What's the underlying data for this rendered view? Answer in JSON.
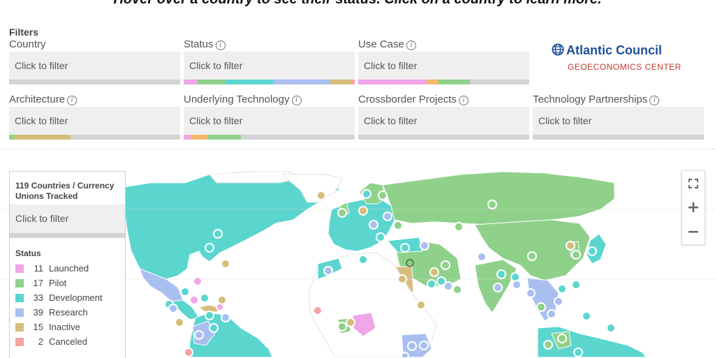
{
  "headline": "Hover over a country to see their status. Click on a country to learn more.",
  "filters": {
    "title": "Filters",
    "placeholder": "Click to filter",
    "info_symbol": "i",
    "items": [
      {
        "label": "Country",
        "has_info": false
      },
      {
        "label": "Status",
        "has_info": true
      },
      {
        "label": "Use Case",
        "has_info": true
      },
      {
        "label": "Architecture",
        "has_info": true
      },
      {
        "label": "Underlying Technology",
        "has_info": true
      },
      {
        "label": "Crossborder Projects",
        "has_info": true
      },
      {
        "label": "Technology Partnerships",
        "has_info": true
      }
    ]
  },
  "logo": {
    "name": "Atlantic Council",
    "subtitle": "GEOECONOMICS CENTER",
    "icon": "globe-icon",
    "color": "#1e4f9a",
    "subtitle_color": "#c0392b"
  },
  "legend": {
    "title": "119 Countries / Currency Unions Tracked",
    "placeholder": "Click to filter",
    "status_title": "Status",
    "statuses": [
      {
        "count": "11",
        "label": "Launched",
        "color": "#f0a6e8"
      },
      {
        "count": "17",
        "label": "Pilot",
        "color": "#8fd18a"
      },
      {
        "count": "33",
        "label": "Development",
        "color": "#5ad6cf"
      },
      {
        "count": "39",
        "label": "Research",
        "color": "#a9bff0"
      },
      {
        "count": "15",
        "label": "Inactive",
        "color": "#d6bd7a"
      },
      {
        "count": "2",
        "label": "Canceled",
        "color": "#f5a3a3"
      }
    ]
  },
  "map_controls": {
    "fullscreen_icon": "fullscreen-icon",
    "zoom_in": "+",
    "zoom_out": "−"
  }
}
